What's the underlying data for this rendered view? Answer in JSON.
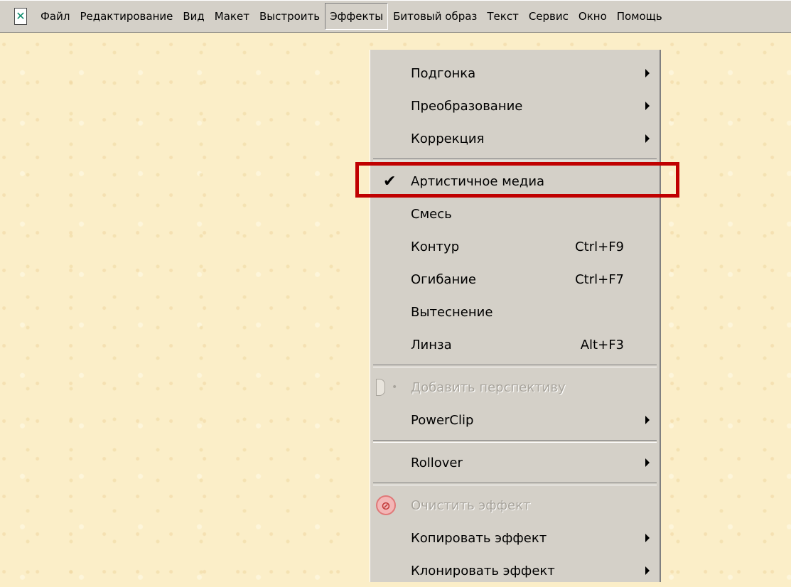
{
  "menubar": {
    "app_icon": "corel-app-icon",
    "items": [
      {
        "label": "Файл"
      },
      {
        "label": "Редактирование"
      },
      {
        "label": "Вид"
      },
      {
        "label": "Макет"
      },
      {
        "label": "Выстроить"
      },
      {
        "label": "Эффекты",
        "open": true
      },
      {
        "label": "Битовый образ"
      },
      {
        "label": "Текст"
      },
      {
        "label": "Сервис"
      },
      {
        "label": "Окно"
      },
      {
        "label": "Помощь"
      }
    ]
  },
  "effects_menu": {
    "items": [
      {
        "label": "Подгонка",
        "submenu": true
      },
      {
        "label": "Преобразование",
        "submenu": true
      },
      {
        "label": "Коррекция",
        "submenu": true
      },
      {
        "label": "Артистичное медиа",
        "checked": true,
        "highlighted": true
      },
      {
        "label": "Смесь"
      },
      {
        "label": "Контур",
        "shortcut": "Ctrl+F9"
      },
      {
        "label": "Огибание",
        "shortcut": "Ctrl+F7"
      },
      {
        "label": "Вытеснение"
      },
      {
        "label": "Линза",
        "shortcut": "Alt+F3"
      },
      {
        "label": "Добавить перспективу",
        "disabled": true
      },
      {
        "label": "PowerClip",
        "submenu": true
      },
      {
        "label": "Rollover",
        "submenu": true
      },
      {
        "label": "Очистить эффект",
        "disabled": true
      },
      {
        "label": "Копировать эффект",
        "submenu": true
      },
      {
        "label": "Клонировать эффект",
        "submenu": true
      }
    ]
  },
  "colors": {
    "highlight_border": "#c00000",
    "menu_background": "#d4d0c8",
    "canvas_background": "#fbeec8"
  }
}
